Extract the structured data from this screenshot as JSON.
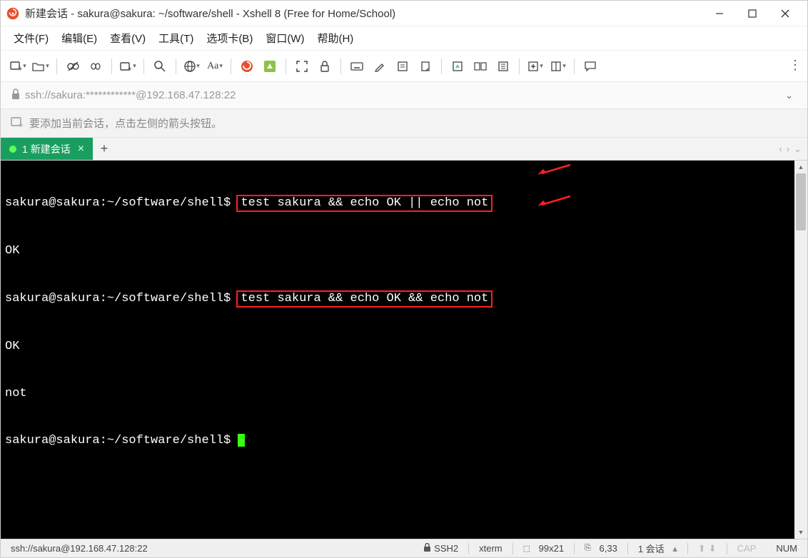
{
  "title": "新建会话 - sakura@sakura: ~/software/shell - Xshell 8 (Free for Home/School)",
  "menu": {
    "file": "文件(F)",
    "edit": "编辑(E)",
    "view": "查看(V)",
    "tools": "工具(T)",
    "tabs": "选项卡(B)",
    "window": "窗口(W)",
    "help": "帮助(H)"
  },
  "toolbar_font_label": "Aa",
  "address": {
    "url": "ssh://sakura:************@192.168.47.128:22"
  },
  "hint": "要添加当前会话，点击左侧的箭头按钮。",
  "tab": {
    "index": "1",
    "name": "新建会话"
  },
  "terminal": {
    "prompt": "sakura@sakura:~/software/shell$",
    "cmd1": "test sakura && echo OK || echo not",
    "out1": "OK",
    "cmd2": "test sakura && echo OK && echo not",
    "out2a": "OK",
    "out2b": "not"
  },
  "status": {
    "conn": "ssh://sakura@192.168.47.128:22",
    "proto": "SSH2",
    "term": "xterm",
    "size": "99x21",
    "pos": "6,33",
    "sessions": "1 会话",
    "cap": "CAP",
    "num": "NUM"
  }
}
